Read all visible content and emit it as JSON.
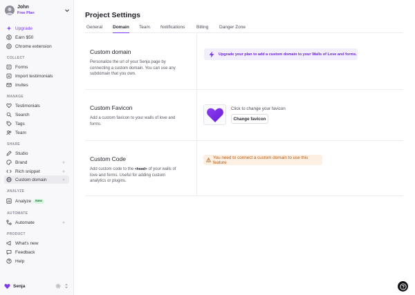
{
  "user": {
    "name": "John",
    "plan": "Free Plan"
  },
  "sidebar": {
    "top_items": [
      {
        "label": "Upgrade",
        "icon": "sparkles-icon"
      },
      {
        "label": "Earn $50",
        "icon": "dollar-icon"
      },
      {
        "label": "Chrome extension",
        "icon": "chrome-icon"
      }
    ],
    "sections": {
      "collect": "COLLECT",
      "manage": "MANAGE",
      "share": "SHARE",
      "analyze": "ANALYZE",
      "automate": "AUTOMATE",
      "product": "PRODUCT"
    },
    "collect_items": [
      {
        "label": "Forms",
        "icon": "form-icon"
      },
      {
        "label": "Import testimonials",
        "icon": "import-icon"
      },
      {
        "label": "Invites",
        "icon": "mail-icon"
      }
    ],
    "manage_items": [
      {
        "label": "Testimonials",
        "icon": "heart-icon"
      },
      {
        "label": "Search",
        "icon": "search-icon"
      },
      {
        "label": "Tags",
        "icon": "tag-icon"
      },
      {
        "label": "Team",
        "icon": "team-icon"
      }
    ],
    "share_items": [
      {
        "label": "Studio",
        "icon": "pen-icon"
      },
      {
        "label": "Brand",
        "icon": "palette-icon"
      },
      {
        "label": "Rich snippet",
        "icon": "code-icon"
      },
      {
        "label": "Custom domain",
        "icon": "globe-icon"
      }
    ],
    "analyze_items": [
      {
        "label": "Analyze",
        "icon": "chart-icon",
        "badge": "New"
      }
    ],
    "automate_items": [
      {
        "label": "Automate",
        "icon": "automate-icon"
      }
    ],
    "product_items": [
      {
        "label": "What's new",
        "icon": "megaphone-icon"
      },
      {
        "label": "Feedback",
        "icon": "chat-icon"
      },
      {
        "label": "Help",
        "icon": "help-icon"
      }
    ],
    "footer": {
      "project": "Senja"
    }
  },
  "page": {
    "title": "Project Settings",
    "tabs": [
      "General",
      "Domain",
      "Team",
      "Notifications",
      "Billing",
      "Danger Zone"
    ],
    "active_tab": "Domain"
  },
  "custom_domain": {
    "title": "Custom domain",
    "description": "Personalize the url of your Senja page by connecting a custom domain. You can use any subdomain that you own.",
    "upgrade_notice": "Upgrade your plan to add a custom domain to your Walls of Love and forms."
  },
  "custom_favicon": {
    "title": "Custom Favicon",
    "description": "Add a custom favicon to your walls of love and forms.",
    "hint": "Click to change your favicon",
    "button": "Change favicon"
  },
  "custom_code": {
    "title": "Custom Code",
    "desc_before": "Add custom code to the",
    "tag": "<head>",
    "desc_after": "of your walls of love and forms. Useful for adding custom analytics or plugins.",
    "warning": "You need to connect a custom domain to use this feature"
  },
  "colors": {
    "accent": "#7c3aed",
    "warning": "#b25a12"
  }
}
